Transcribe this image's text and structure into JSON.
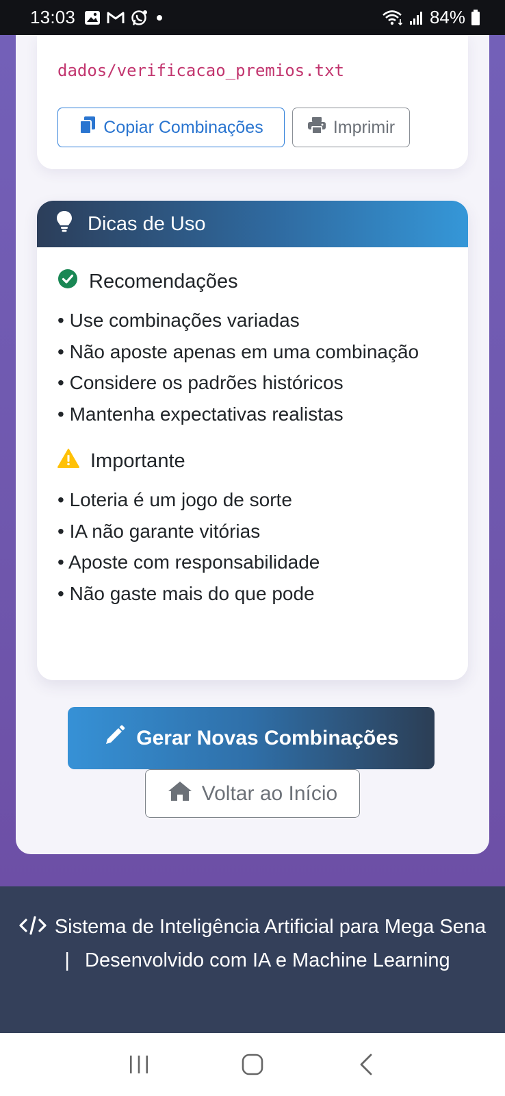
{
  "status_bar": {
    "time": "13:03",
    "battery": "84%",
    "notification_icons": [
      "image-icon",
      "gmail-icon",
      "whatsapp-icon",
      "dot-icon"
    ],
    "system_icons": [
      "wifi-icon",
      "signal-icon",
      "battery-icon"
    ]
  },
  "results_card": {
    "file_path": "dados/verificacao_premios.txt",
    "copy_label": "Copiar Combinações",
    "print_label": "Imprimir"
  },
  "tips": {
    "title": "Dicas de Uso",
    "recommendations": {
      "title": "Recomendações",
      "items": [
        "Use combinações variadas",
        "Não aposte apenas em uma combinação",
        "Considere os padrões históricos",
        "Mantenha expectativas realistas"
      ]
    },
    "important": {
      "title": "Importante",
      "items": [
        "Loteria é um jogo de sorte",
        "IA não garante vitórias",
        "Aposte com responsabilidade",
        "Não gaste mais do que pode"
      ]
    }
  },
  "actions": {
    "generate_label": "Gerar Novas Combinações",
    "home_label": "Voltar ao Início"
  },
  "footer": {
    "text_main": "Sistema de Inteligência Artificial para Mega Sena",
    "separator": "|",
    "text_dev": "Desenvolvido com IA e Machine Learning"
  },
  "colors": {
    "primary": "#2a75d0",
    "success": "#198754",
    "warning": "#ffc107",
    "code": "#c2366f",
    "footer_bg": "#34405a",
    "page_bg": "#7360b8"
  }
}
